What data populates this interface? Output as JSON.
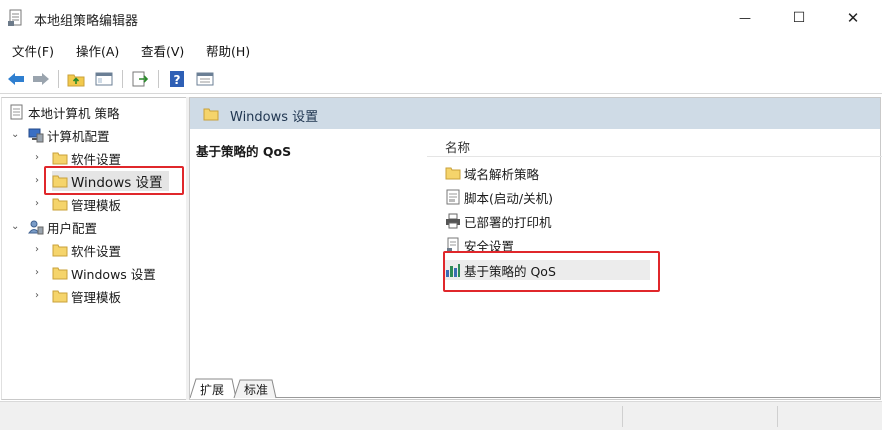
{
  "window": {
    "title": "本地组策略编辑器",
    "minimize_glyph": "—",
    "maximize_glyph": "☐",
    "close_glyph": "✕"
  },
  "menu": {
    "items": [
      "文件(F)",
      "操作(A)",
      "查看(V)",
      "帮助(H)"
    ]
  },
  "toolbar": {
    "icons": [
      "back-arrow-icon",
      "forward-arrow-icon",
      "up-folder-icon",
      "show-hide-tree-icon",
      "export-list-icon",
      "help-icon",
      "properties-icon"
    ]
  },
  "tree": {
    "root": "本地计算机 策略",
    "computer_config": "计算机配置",
    "computer_children": [
      "软件设置",
      "Windows 设置",
      "管理模板"
    ],
    "user_config": "用户配置",
    "user_children": [
      "软件设置",
      "Windows 设置",
      "管理模板"
    ]
  },
  "right": {
    "header": "Windows 设置",
    "description_title": "基于策略的 QoS",
    "column_name": "名称",
    "items": [
      "域名解析策略",
      "脚本(启动/关机)",
      "已部署的打印机",
      "安全设置",
      "基于策略的 QoS"
    ],
    "item_icons": [
      "folder-icon",
      "script-icon",
      "printer-icon",
      "security-icon",
      "qos-chart-icon"
    ]
  },
  "tabs": [
    "扩展",
    "标准"
  ],
  "colors": {
    "highlight_red": "#e0272b",
    "header_blue": "#cfdbe6",
    "folder_yellow": "#f5d46b"
  }
}
